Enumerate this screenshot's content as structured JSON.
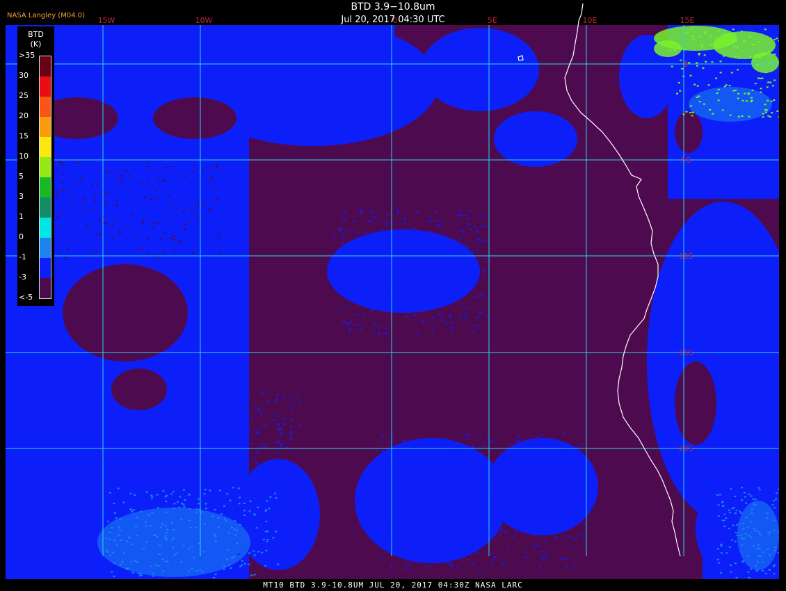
{
  "header": {
    "producer": "NASA Langley (M04.0)",
    "title": "BTD 3.9−10.8um",
    "subtitle": "Jul 20, 2017 04:30 UTC"
  },
  "footer": "MT10  BTD 3.9-10.8UM  JUL 20, 2017 04:30Z  NASA LARC",
  "map": {
    "longitude_labels": [
      "15W",
      "10W",
      "0",
      "5E",
      "10E",
      "15E"
    ],
    "latitude_labels": [
      "0",
      "5S",
      "10S",
      "15S",
      "20S"
    ],
    "grid_color": "#27d8e8",
    "label_color": "#c52733",
    "coastline_color": "#ffffff",
    "colors": {
      "background_class": "#4e0a4f",
      "cloud_class": "#0d1ff8",
      "light_cloud_class": "#1a86f2",
      "high_value_class": "#7af22b"
    }
  },
  "legend": {
    "title": "BTD",
    "units": "(K)",
    "entries": [
      {
        "label": ">35",
        "color": "#6b0016"
      },
      {
        "label": "30",
        "color": "#ea0d11"
      },
      {
        "label": "25",
        "color": "#f65714"
      },
      {
        "label": "20",
        "color": "#fc9a0e"
      },
      {
        "label": "15",
        "color": "#fde80d"
      },
      {
        "label": "10",
        "color": "#97e817"
      },
      {
        "label": "5",
        "color": "#18ba23"
      },
      {
        "label": "3",
        "color": "#118e66"
      },
      {
        "label": "1",
        "color": "#00e6e6"
      },
      {
        "label": "0",
        "color": "#1d83f0"
      },
      {
        "label": "-1",
        "color": "#0d1ff8"
      },
      {
        "label": "-3",
        "color": "#4e0a4f"
      },
      {
        "label": "<-5",
        "color": ""
      }
    ]
  }
}
